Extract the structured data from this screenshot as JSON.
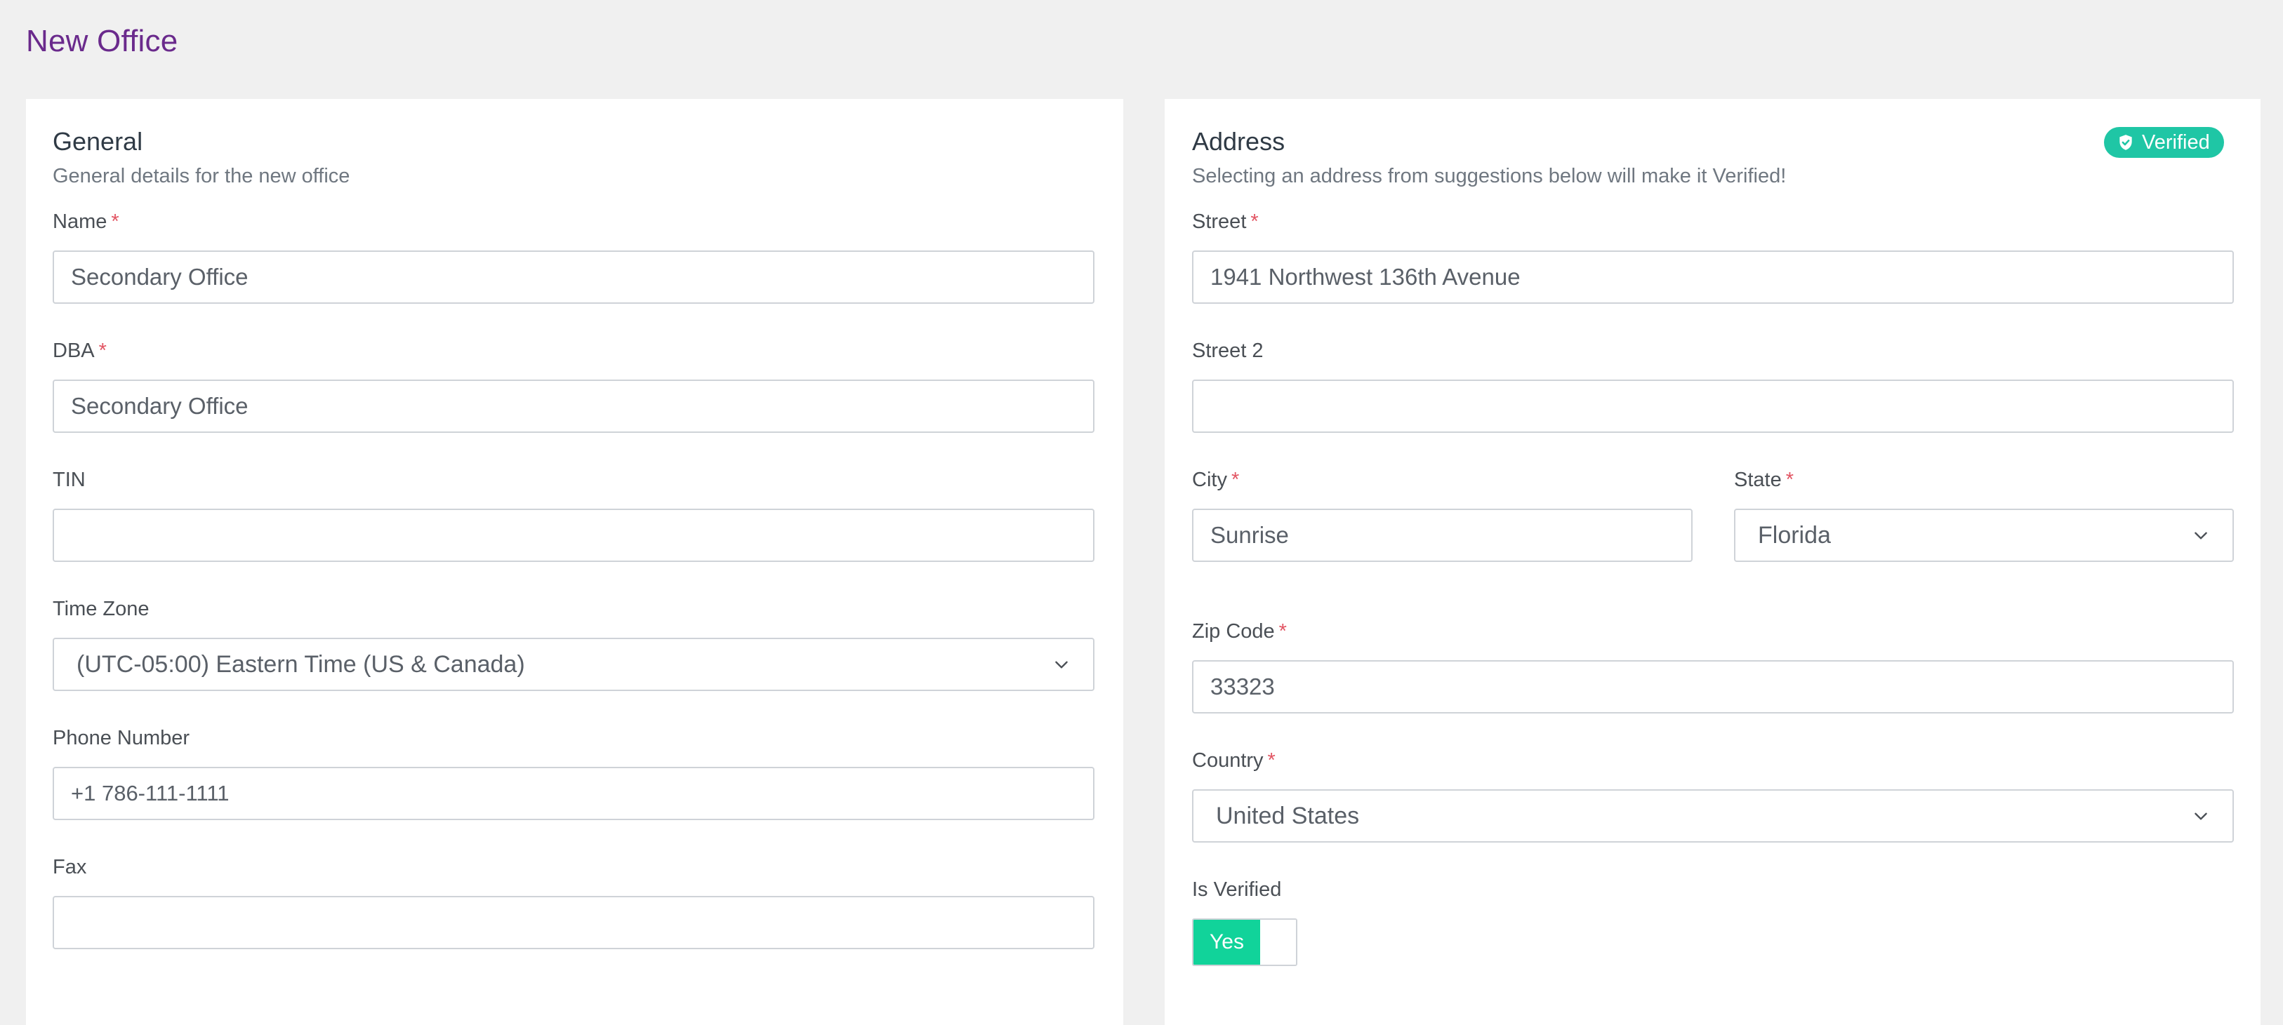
{
  "page": {
    "title": "New Office"
  },
  "general": {
    "title": "General",
    "subtitle": "General details for the new office",
    "name": {
      "label": "Name",
      "required_mark": "*",
      "value": "Secondary Office"
    },
    "dba": {
      "label": "DBA",
      "required_mark": "*",
      "value": "Secondary Office"
    },
    "tin": {
      "label": "TIN",
      "value": ""
    },
    "timezone": {
      "label": "Time Zone",
      "value": "(UTC-05:00) Eastern Time (US & Canada)"
    },
    "phone": {
      "label": "Phone Number",
      "value": "+1 786-111-1111"
    },
    "fax": {
      "label": "Fax",
      "value": ""
    }
  },
  "address": {
    "title": "Address",
    "subtitle": "Selecting an address from suggestions below will make it Verified!",
    "badge": {
      "label": "Verified",
      "icon": "shield-check-icon",
      "color": "#1fc6a5"
    },
    "street": {
      "label": "Street",
      "required_mark": "*",
      "value": "1941 Northwest 136th Avenue"
    },
    "street2": {
      "label": "Street 2",
      "value": ""
    },
    "city": {
      "label": "City",
      "required_mark": "*",
      "value": "Sunrise"
    },
    "state": {
      "label": "State",
      "required_mark": "*",
      "value": "Florida"
    },
    "zip": {
      "label": "Zip Code",
      "required_mark": "*",
      "value": "33323"
    },
    "country": {
      "label": "Country",
      "required_mark": "*",
      "value": "United States"
    },
    "is_verified": {
      "label": "Is Verified",
      "toggle_label": "Yes",
      "on": true,
      "color": "#11d39a"
    }
  },
  "colors": {
    "accent_title": "#6a2a8c",
    "required": "#e25563",
    "background": "#f0f0f0"
  }
}
